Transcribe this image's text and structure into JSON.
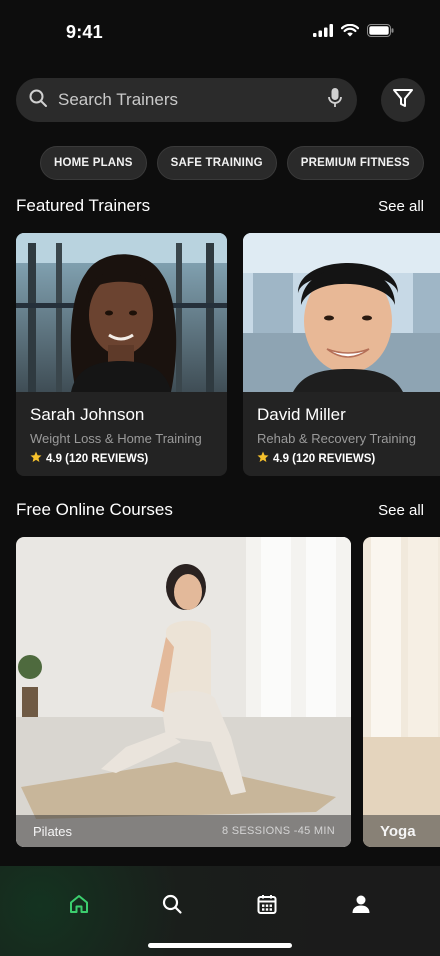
{
  "status_bar": {
    "time": "9:41"
  },
  "search": {
    "placeholder": "Search Trainers"
  },
  "chips": [
    "HOME PLANS",
    "SAFE TRAINING",
    "PREMIUM FITNESS"
  ],
  "featured": {
    "title": "Featured Trainers",
    "see_all": "See all",
    "trainers": [
      {
        "name": "Sarah Johnson",
        "specialty": "Weight Loss & Home Training",
        "rating": "4.9 (120 REVIEWS)"
      },
      {
        "name": "David Miller",
        "specialty": "Rehab & Recovery Training",
        "rating": "4.9 (120 REVIEWS)"
      }
    ]
  },
  "courses": {
    "title": "Free Online Courses",
    "see_all": "See all",
    "items": [
      {
        "name": "Pilates",
        "meta": "8 SESSIONS -45 MIN"
      },
      {
        "name": "Yoga",
        "meta": ""
      }
    ]
  },
  "nav": {
    "items": [
      {
        "icon": "home-icon",
        "active": true
      },
      {
        "icon": "search-icon",
        "active": false
      },
      {
        "icon": "calendar-icon",
        "active": false
      },
      {
        "icon": "profile-icon",
        "active": false
      }
    ],
    "active_color": "#3ccf6e"
  }
}
